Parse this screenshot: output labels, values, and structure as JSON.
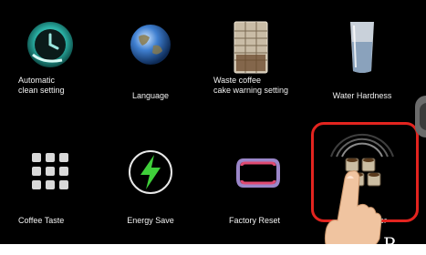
{
  "settings_grid": {
    "row1": [
      {
        "label": "Automatic\nclean setting",
        "icon": "clock-clean-icon"
      },
      {
        "label": "Language",
        "icon": "globe-icon"
      },
      {
        "label": "Waste coffee\ncake warning setting",
        "icon": "coffee-grounds-bin-icon"
      },
      {
        "label": "Water Hardness",
        "icon": "water-glass-icon"
      }
    ],
    "row2": [
      {
        "label": "Coffee Taste",
        "icon": "bean-grid-icon"
      },
      {
        "label": "Energy Save",
        "icon": "lightning-icon"
      },
      {
        "label": "Factory Reset",
        "icon": "reset-frame-icon"
      },
      {
        "label": "unter",
        "icon": "cups-counter-icon"
      }
    ]
  },
  "colors": {
    "screen_bg": "#000000",
    "highlight": "#e3241f",
    "label_text": "#f2f2f2"
  },
  "corner_text": "P"
}
